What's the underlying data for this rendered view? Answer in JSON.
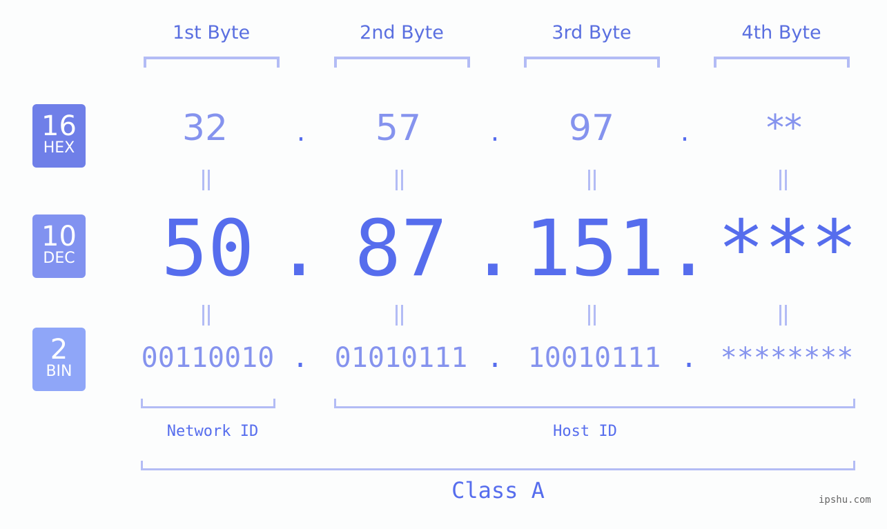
{
  "headers": [
    "1st Byte",
    "2nd Byte",
    "3rd Byte",
    "4th Byte"
  ],
  "badges": [
    {
      "num": "16",
      "label": "HEX",
      "color": "#6f7fe8"
    },
    {
      "num": "10",
      "label": "DEC",
      "color": "#8192f0"
    },
    {
      "num": "2",
      "label": "BIN",
      "color": "#8fa6f8"
    }
  ],
  "hex": [
    "32",
    "57",
    "97",
    "**"
  ],
  "dec": [
    "50",
    "87",
    "151",
    "***"
  ],
  "bin": [
    "00110010",
    "01010111",
    "10010111",
    "********"
  ],
  "separator": ".",
  "network_label": "Network ID",
  "host_label": "Host ID",
  "class_label": "Class A",
  "watermark": "ipshu.com",
  "colors": {
    "accent": "#566ded",
    "light": "#8593ee",
    "bracket": "#b3bcf5"
  }
}
